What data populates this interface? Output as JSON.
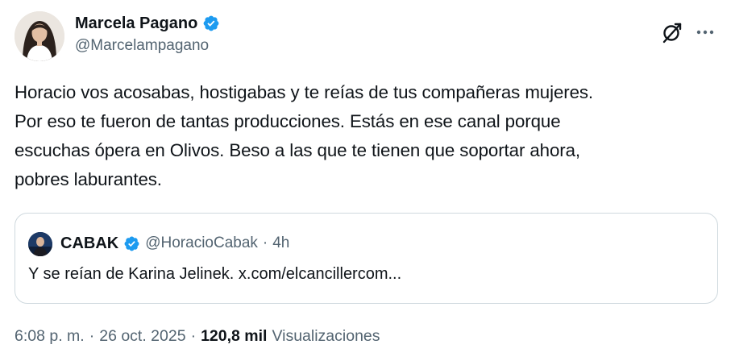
{
  "author": {
    "name": "Marcela Pagano",
    "handle": "@Marcelampagano",
    "verified": true
  },
  "tweet": {
    "text": "Horacio vos acosabas, hostigabas y te reías de tus compañeras mujeres.\nPor eso te fueron de tantas producciones. Estás en ese canal porque\nescuchas ópera en Olivos. Beso a las que te tienen que soportar ahora,\npobres laburantes."
  },
  "quote": {
    "name": "CABAK",
    "handle": "@HoracioCabak",
    "separator": "·",
    "time": "4h",
    "verified": true,
    "text": "Y se reían de Karina Jelinek. x.com/elcancillercom..."
  },
  "meta": {
    "time": "6:08 p. m.",
    "separator1": "·",
    "date": "26 oct. 2025",
    "separator2": "·",
    "views_count": "120,8 mil",
    "views_label": "Visualizaciones"
  },
  "icons": {
    "verified": "verified-badge-icon",
    "grok": "grok-icon",
    "more": "more-icon"
  },
  "colors": {
    "verified_blue": "#1d9bf0",
    "text_primary": "#0f1419",
    "text_secondary": "#536471",
    "border": "#cfd9de"
  }
}
